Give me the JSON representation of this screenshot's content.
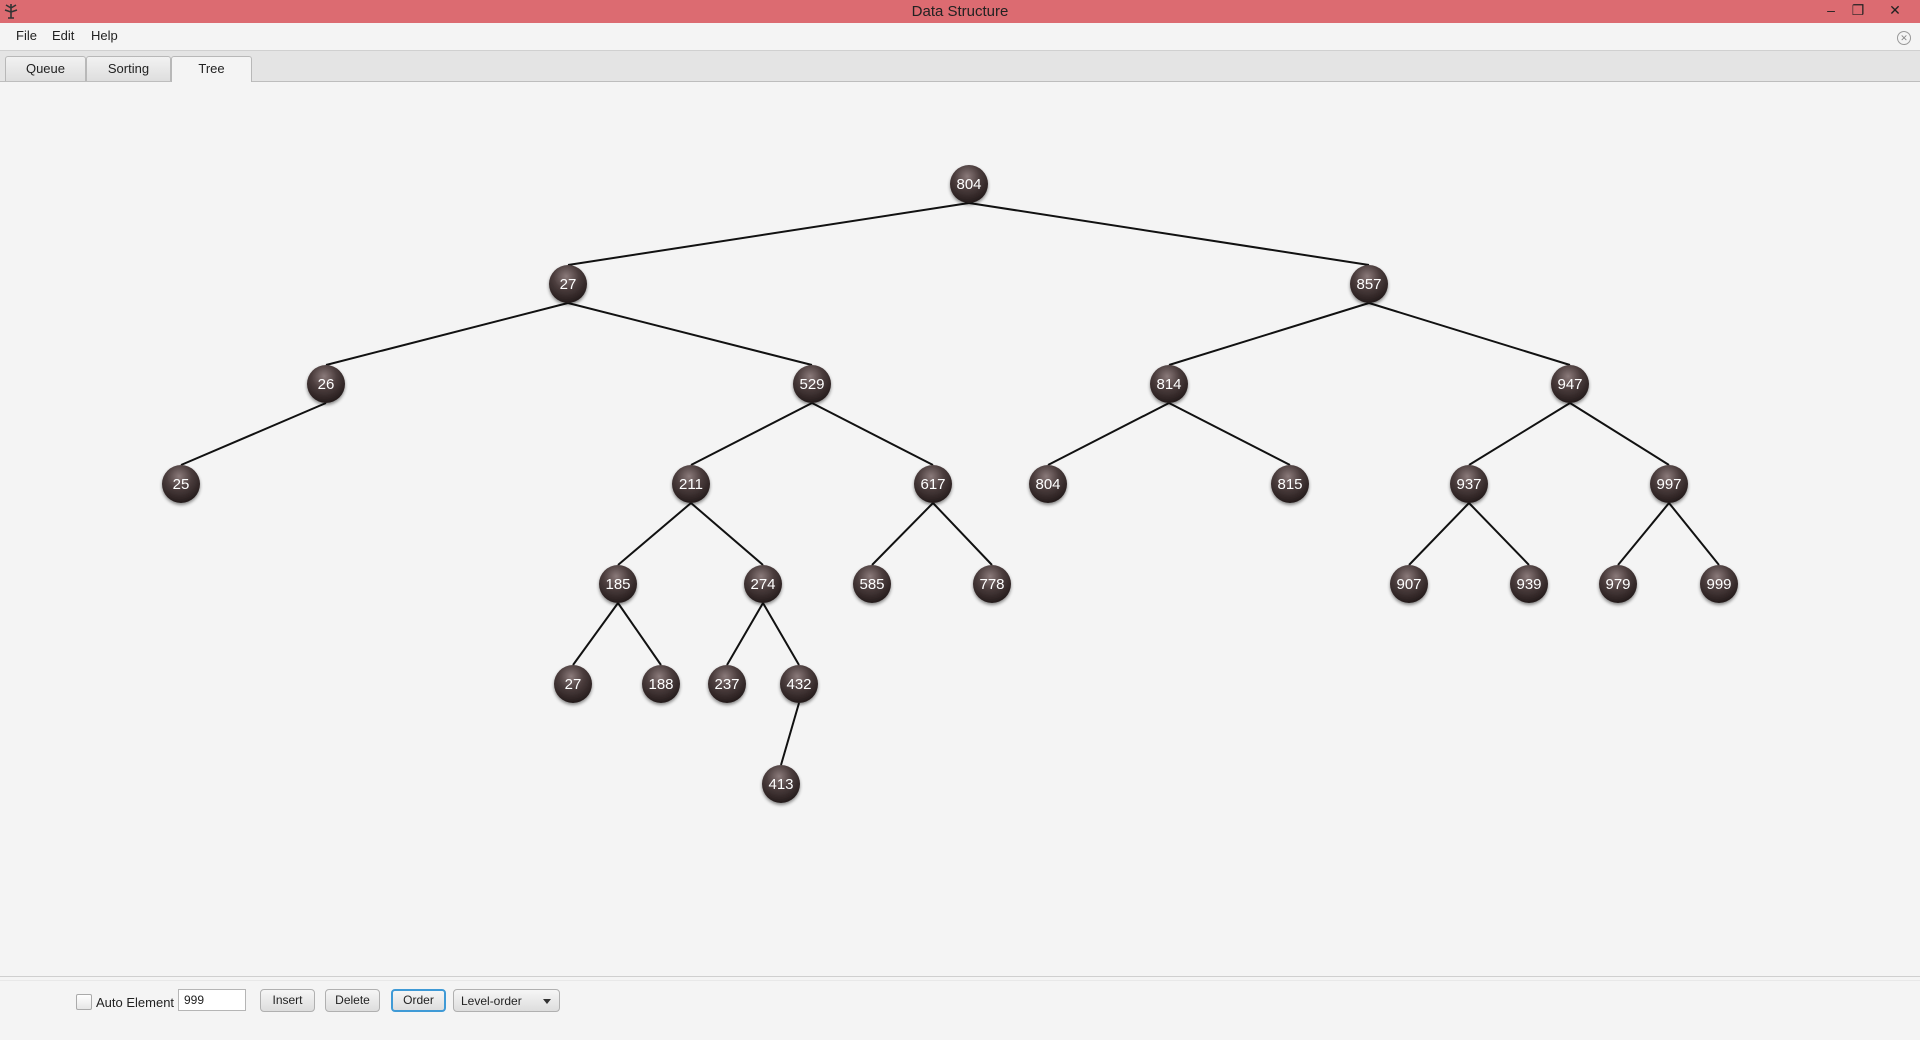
{
  "window": {
    "title": "Data Structure"
  },
  "menu": {
    "items": [
      "File",
      "Edit",
      "Help"
    ]
  },
  "tabs": [
    "Queue",
    "Sorting",
    "Tree"
  ],
  "active_tab": "Tree",
  "tree": {
    "node_color": "#3a2e2e",
    "edge_color": "#111111",
    "nodes": [
      {
        "id": "n1",
        "value": "804",
        "level": 0
      },
      {
        "id": "n2",
        "value": "27",
        "level": 1,
        "parent": "n1"
      },
      {
        "id": "n3",
        "value": "857",
        "level": 1,
        "parent": "n1"
      },
      {
        "id": "n4",
        "value": "26",
        "level": 2,
        "parent": "n2"
      },
      {
        "id": "n5",
        "value": "529",
        "level": 2,
        "parent": "n2"
      },
      {
        "id": "n6",
        "value": "814",
        "level": 2,
        "parent": "n3"
      },
      {
        "id": "n7",
        "value": "947",
        "level": 2,
        "parent": "n3"
      },
      {
        "id": "n8",
        "value": "25",
        "level": 3,
        "parent": "n4"
      },
      {
        "id": "n9",
        "value": "211",
        "level": 3,
        "parent": "n5"
      },
      {
        "id": "n10",
        "value": "617",
        "level": 3,
        "parent": "n5"
      },
      {
        "id": "n11",
        "value": "804",
        "level": 3,
        "parent": "n6"
      },
      {
        "id": "n12",
        "value": "815",
        "level": 3,
        "parent": "n6"
      },
      {
        "id": "n13",
        "value": "937",
        "level": 3,
        "parent": "n7"
      },
      {
        "id": "n14",
        "value": "997",
        "level": 3,
        "parent": "n7"
      },
      {
        "id": "n15",
        "value": "185",
        "level": 4,
        "parent": "n9"
      },
      {
        "id": "n16",
        "value": "274",
        "level": 4,
        "parent": "n9"
      },
      {
        "id": "n17",
        "value": "585",
        "level": 4,
        "parent": "n10"
      },
      {
        "id": "n18",
        "value": "778",
        "level": 4,
        "parent": "n10"
      },
      {
        "id": "n19",
        "value": "907",
        "level": 4,
        "parent": "n13"
      },
      {
        "id": "n20",
        "value": "939",
        "level": 4,
        "parent": "n13"
      },
      {
        "id": "n21",
        "value": "979",
        "level": 4,
        "parent": "n14"
      },
      {
        "id": "n22",
        "value": "999",
        "level": 4,
        "parent": "n14"
      },
      {
        "id": "n23",
        "value": "27",
        "level": 5,
        "parent": "n15"
      },
      {
        "id": "n24",
        "value": "188",
        "level": 5,
        "parent": "n15"
      },
      {
        "id": "n25",
        "value": "237",
        "level": 5,
        "parent": "n16"
      },
      {
        "id": "n26",
        "value": "432",
        "level": 5,
        "parent": "n16"
      },
      {
        "id": "n27",
        "value": "413",
        "level": 6,
        "parent": "n26"
      }
    ]
  },
  "controls": {
    "auto_element_label": "Auto Element",
    "auto_element_checked": false,
    "element_value": "999",
    "insert_label": "Insert",
    "delete_label": "Delete",
    "order_label": "Order",
    "order_mode": "Level-order"
  }
}
